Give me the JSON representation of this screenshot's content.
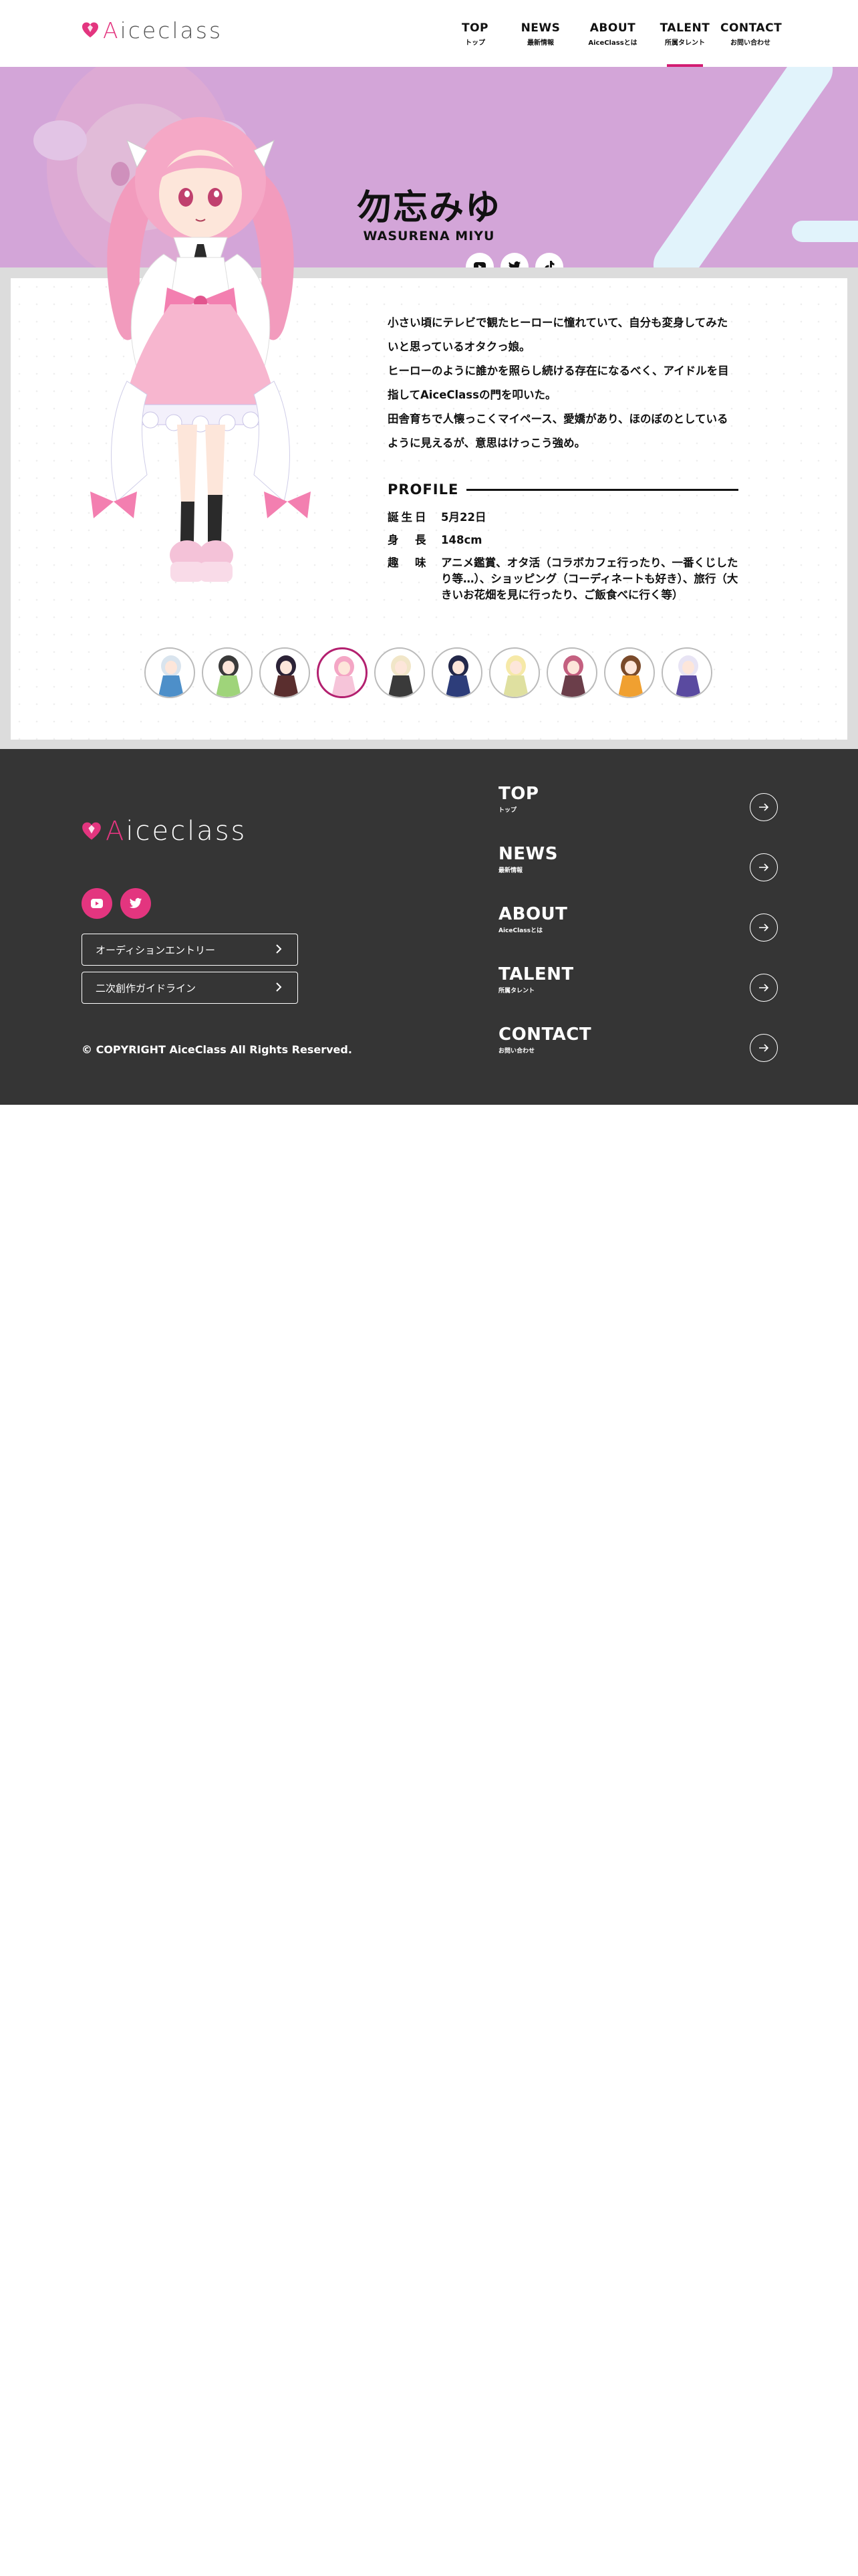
{
  "brand": {
    "logo_prefix": "A",
    "logo_rest": "iceclass",
    "heart_color": "#e3357f"
  },
  "nav": {
    "items": [
      {
        "en": "TOP",
        "jp": "トップ"
      },
      {
        "en": "NEWS",
        "jp": "最新情報"
      },
      {
        "en": "ABOUT",
        "jp": "AiceClassとは"
      },
      {
        "en": "TALENT",
        "jp": "所属タレント"
      },
      {
        "en": "CONTACT",
        "jp": "お問い合わせ"
      }
    ],
    "active": "TALENT",
    "accent": "#d21c72"
  },
  "hero": {
    "name": "勿忘みゆ",
    "roman": "WASURENA MIYU",
    "bg_color": "#d3a5d8",
    "social": [
      "youtube-icon",
      "twitter-icon",
      "tiktok-icon"
    ]
  },
  "talent": {
    "description": [
      "小さい頃にテレビで観たヒーローに憧れていて、自分も変身してみたいと思っているオタクっ娘。",
      "ヒーローのように誰かを照らし続ける存在になるべく、アイドルを目指してAiceClassの門を叩いた。",
      "田舎育ちで人懐っこくマイペース、愛嬌があり、ほのぼのとしているように見えるが、意思はけっこう強め。"
    ],
    "profile_title": "PROFILE",
    "profile": [
      {
        "key": "誕生日",
        "value": "5月22日"
      },
      {
        "key": "身　長",
        "value": "148cm"
      },
      {
        "key": "趣　味",
        "value": "アニメ鑑賞、オタ活（コラボカフェ行ったり、一番くじしたり等…）、ショッピング（コーディネートも好き）、旅行（大きいお花畑を見に行ったり、ご飯食べに行く等）"
      }
    ],
    "thumbnails": [
      {
        "name": "talent-1",
        "hair": "#d9e4ee",
        "cloth": "#4d8fc9"
      },
      {
        "name": "talent-2",
        "hair": "#3a3a3a",
        "cloth": "#9fd47a"
      },
      {
        "name": "talent-3",
        "hair": "#2b2236",
        "cloth": "#5a2e2e"
      },
      {
        "name": "talent-4",
        "hair": "#f4a6c5",
        "cloth": "#f6c4d9"
      },
      {
        "name": "talent-5",
        "hair": "#f1e6c8",
        "cloth": "#3a3a3a"
      },
      {
        "name": "talent-6",
        "hair": "#23284a",
        "cloth": "#2d3d7a"
      },
      {
        "name": "talent-7",
        "hair": "#f6e9a8",
        "cloth": "#dfe0a0"
      },
      {
        "name": "talent-8",
        "hair": "#c46080",
        "cloth": "#6b3e4a"
      },
      {
        "name": "talent-9",
        "hair": "#7a4a2a",
        "cloth": "#f0a030"
      },
      {
        "name": "talent-10",
        "hair": "#e8e4f4",
        "cloth": "#5a4aa0"
      }
    ],
    "active_thumbnail": 3
  },
  "footer": {
    "buttons": [
      "オーディションエントリー",
      "二次創作ガイドライン"
    ],
    "copyright": "© COPYRIGHT AiceClass All Rights Reserved.",
    "nav": [
      {
        "en": "TOP",
        "jp": "トップ"
      },
      {
        "en": "NEWS",
        "jp": "最新情報"
      },
      {
        "en": "ABOUT",
        "jp": "AiceClassとは"
      },
      {
        "en": "TALENT",
        "jp": "所属タレント"
      },
      {
        "en": "CONTACT",
        "jp": "お問い合わせ"
      }
    ]
  }
}
